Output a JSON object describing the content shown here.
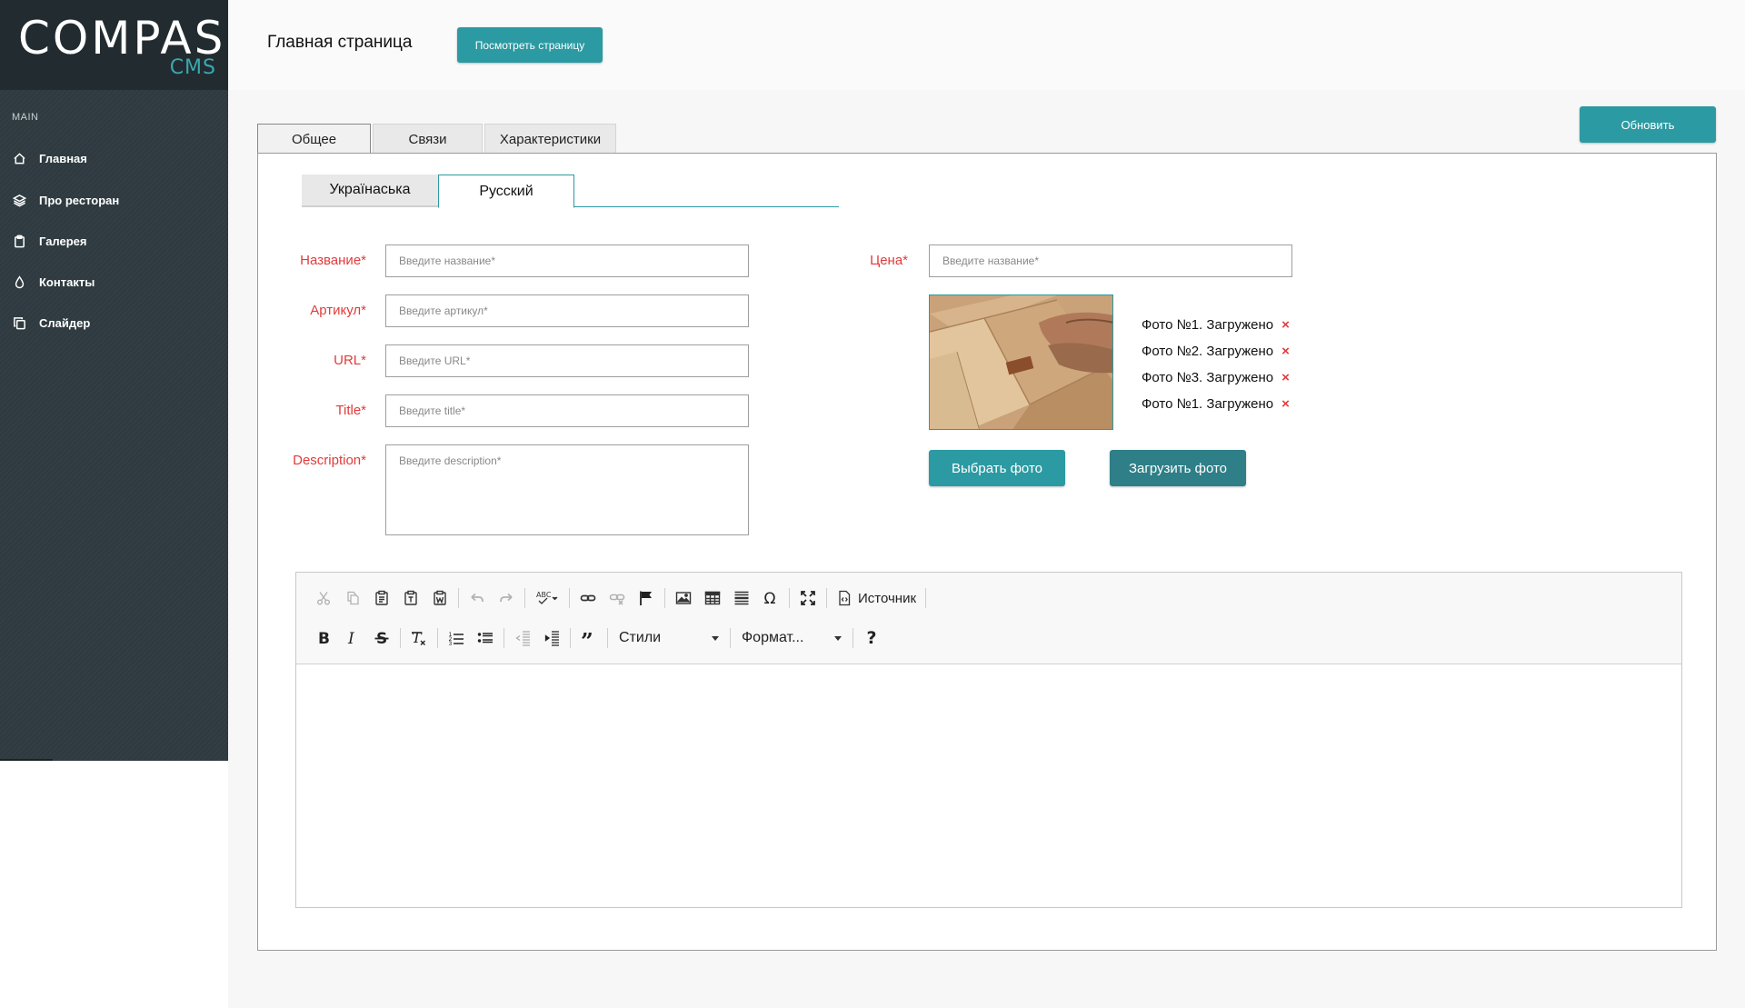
{
  "brand": {
    "name": "COMPAS",
    "sub": "CMS"
  },
  "sidebar": {
    "section": "MAIN",
    "items": [
      {
        "label": "Главная",
        "icon": "home-icon"
      },
      {
        "label": "Про ресторан",
        "icon": "layers-icon"
      },
      {
        "label": "Галерея",
        "icon": "clipboard-icon"
      },
      {
        "label": "Контакты",
        "icon": "drop-icon"
      },
      {
        "label": "Слайдер",
        "icon": "copy-icon"
      }
    ]
  },
  "header": {
    "title": "Главная страница",
    "view_button": "Посмотреть страницу",
    "update_button": "Обновить"
  },
  "tabs": [
    "Общее",
    "Связи",
    "Характеристики"
  ],
  "lang_tabs": [
    "Українаська",
    "Русский"
  ],
  "form": {
    "name": {
      "label": "Название*",
      "placeholder": "Введите название*"
    },
    "sku": {
      "label": "Артикул*",
      "placeholder": "Введите артикул*"
    },
    "url": {
      "label": "URL*",
      "placeholder": "Введите URL*"
    },
    "title": {
      "label": "Title*",
      "placeholder": "Введите title*"
    },
    "description": {
      "label": "Description*",
      "placeholder": "Введите description*"
    },
    "price": {
      "label": "Цена*",
      "placeholder": "Введите название*"
    }
  },
  "photos": {
    "list": [
      "Фото №1. Загружено",
      "Фото №2. Загружено",
      "Фото №3. Загружено",
      "Фото №1. Загружено"
    ],
    "remove": "×",
    "choose_button": "Выбрать фото",
    "upload_button": "Загрузить фото"
  },
  "editor": {
    "source_label": "Источник",
    "styles_label": "Стили",
    "format_label": "Формат...",
    "help_label": "?"
  },
  "colors": {
    "accent": "#2c9aa2",
    "sidebar": "#2f3b40",
    "required": "#e23b3b"
  }
}
